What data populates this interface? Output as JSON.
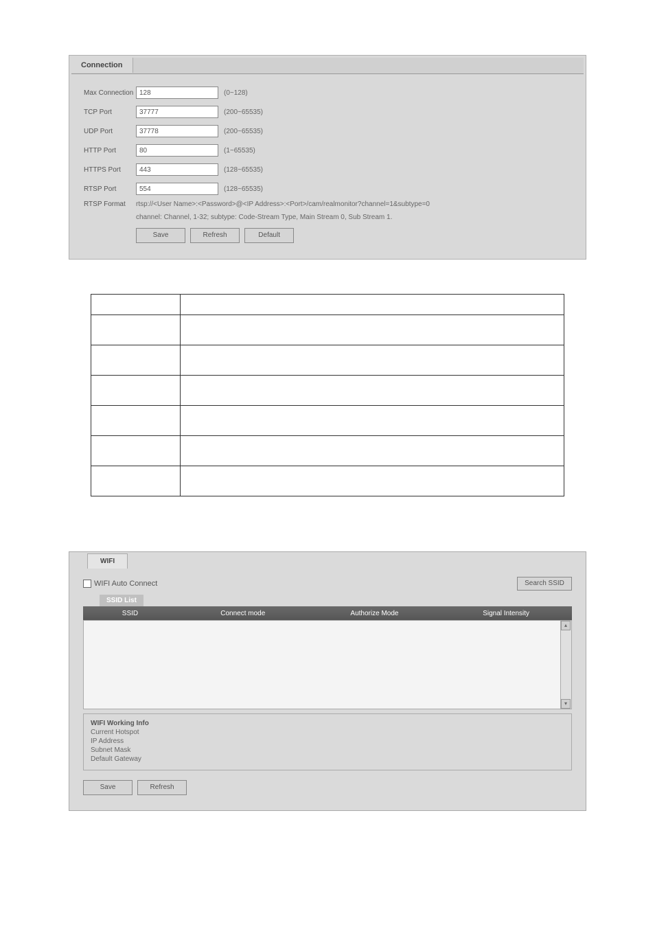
{
  "connection": {
    "tab_label": "Connection",
    "rows": {
      "max_connection": {
        "label": "Max Connection",
        "value": "128",
        "hint": "(0~128)"
      },
      "tcp_port": {
        "label": "TCP Port",
        "value": "37777",
        "hint": "(200~65535)"
      },
      "udp_port": {
        "label": "UDP Port",
        "value": "37778",
        "hint": "(200~65535)"
      },
      "http_port": {
        "label": "HTTP Port",
        "value": "80",
        "hint": "(1~65535)"
      },
      "https_port": {
        "label": "HTTPS Port",
        "value": "443",
        "hint": "(128~65535)"
      },
      "rtsp_port": {
        "label": "RTSP Port",
        "value": "554",
        "hint": "(128~65535)"
      }
    },
    "rtsp_format_label": "RTSP Format",
    "rtsp_format_line1": "rtsp://<User Name>:<Password>@<IP Address>:<Port>/cam/realmonitor?channel=1&subtype=0",
    "rtsp_format_line2": "channel: Channel, 1-32; subtype: Code-Stream Type, Main Stream 0, Sub Stream 1.",
    "buttons": {
      "save": "Save",
      "refresh": "Refresh",
      "default": "Default"
    }
  },
  "param_table": {
    "headers": [
      "",
      ""
    ],
    "rows": [
      [
        "",
        ""
      ],
      [
        "",
        ""
      ],
      [
        "",
        ""
      ],
      [
        "",
        ""
      ],
      [
        "",
        ""
      ],
      [
        "",
        ""
      ]
    ]
  },
  "wifi": {
    "tab_label": "WIFI",
    "auto_connect_label": "WIFI Auto Connect",
    "search_ssid_label": "Search SSID",
    "ssid_list_label": "SSID List",
    "columns": {
      "ssid": "SSID",
      "connect_mode": "Connect mode",
      "authorize_mode": "Authorize Mode",
      "signal": "Signal Intensity"
    },
    "working_info": {
      "title": "WIFI Working Info",
      "current_hotspot": "Current Hotspot",
      "ip_address": "IP Address",
      "subnet_mask": "Subnet Mask",
      "default_gateway": "Default Gateway"
    },
    "buttons": {
      "save": "Save",
      "refresh": "Refresh"
    }
  }
}
